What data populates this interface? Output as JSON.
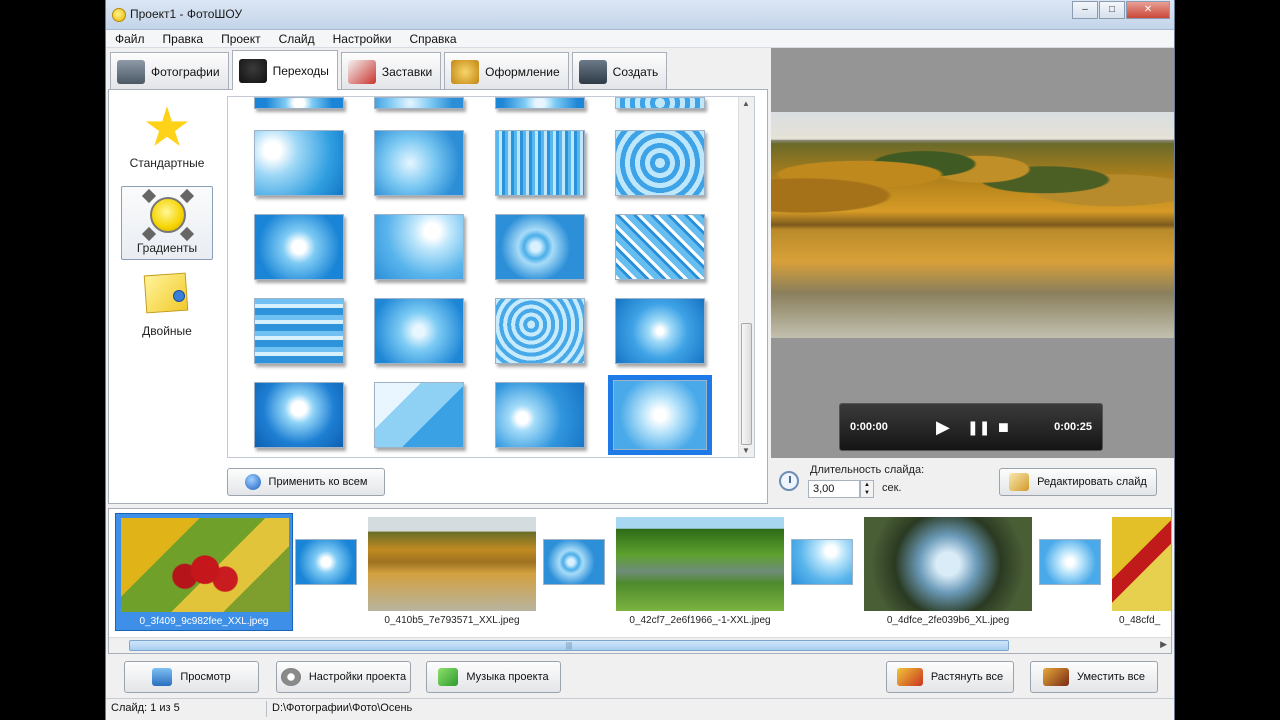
{
  "window": {
    "title": "Проект1 - ФотоШОУ",
    "min": "–",
    "max": "□",
    "close": "✕"
  },
  "menu": [
    "Файл",
    "Правка",
    "Проект",
    "Слайд",
    "Настройки",
    "Справка"
  ],
  "tabs": [
    "Фотографии",
    "Переходы",
    "Заставки",
    "Оформление",
    "Создать"
  ],
  "active_tab": "Переходы",
  "categories": [
    "Стандартные",
    "Градиенты",
    "Двойные"
  ],
  "active_category": "Градиенты",
  "apply_all_label": "Применить ко всем",
  "player": {
    "time_start": "0:00:00",
    "time_end": "0:00:25",
    "play": "▶",
    "pause": "❚❚",
    "stop": "■"
  },
  "duration": {
    "label": "Длительность слайда:",
    "value": "3,00",
    "unit": "сек."
  },
  "edit_slide_label": "Редактировать слайд",
  "filmstrip": [
    "0_3f409_9c982fee_XXL.jpeg",
    "0_410b5_7e793571_XXL.jpeg",
    "0_42cf7_2e6f1966_-1-XXL.jpeg",
    "0_4dfce_2fe039b6_XL.jpeg",
    "0_48cfd_"
  ],
  "bottom_buttons": {
    "preview": "Просмотр",
    "project_settings": "Настройки проекта",
    "music": "Музыка проекта",
    "stretch_all": "Растянуть все",
    "fit_all": "Уместить все"
  },
  "status": {
    "slide": "Слайд: 1 из 5",
    "path": "D:\\Фотографии\\Фото\\Осень"
  },
  "colors": {
    "selection": "#1e7ae6",
    "window_bg": "#f0f0f0"
  }
}
